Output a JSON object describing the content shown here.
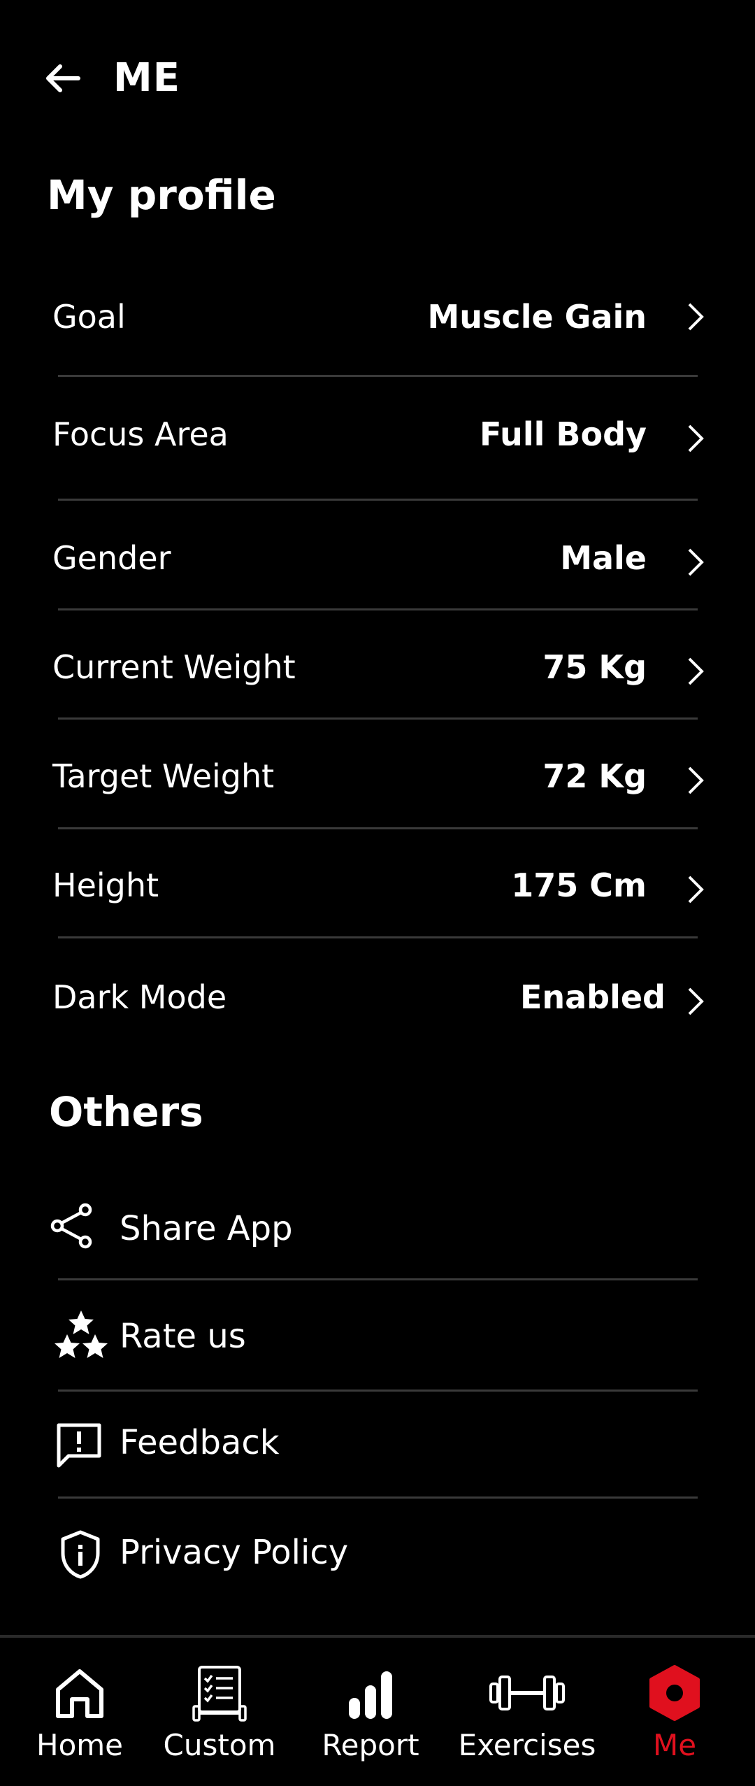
{
  "header": {
    "title": "ME",
    "back_icon": "back-arrow-icon"
  },
  "profile": {
    "title": "My profile",
    "rows": [
      {
        "label": "Goal",
        "value": "Muscle Gain"
      },
      {
        "label": "Focus Area",
        "value": "Full Body"
      },
      {
        "label": "Gender",
        "value": "Male"
      },
      {
        "label": "Current Weight",
        "value": "75 Kg"
      },
      {
        "label": "Target Weight",
        "value": "72 Kg"
      },
      {
        "label": "Height",
        "value": "175 Cm"
      },
      {
        "label": "Dark Mode",
        "value": "Enabled"
      }
    ]
  },
  "others": {
    "title": "Others",
    "items": [
      {
        "label": "Share App",
        "icon": "share-icon"
      },
      {
        "label": "Rate us",
        "icon": "stars-icon"
      },
      {
        "label": "Feedback",
        "icon": "feedback-icon"
      },
      {
        "label": "Privacy Policy",
        "icon": "shield-icon"
      }
    ]
  },
  "bottom_nav": {
    "active_color": "#e0101e",
    "items": [
      {
        "label": "Home",
        "icon": "home-icon"
      },
      {
        "label": "Custom",
        "icon": "clipboard-icon"
      },
      {
        "label": "Report",
        "icon": "bar-chart-icon"
      },
      {
        "label": "Exercises",
        "icon": "dumbbell-icon"
      },
      {
        "label": "Me",
        "icon": "hexagon-icon",
        "active": true
      }
    ]
  }
}
